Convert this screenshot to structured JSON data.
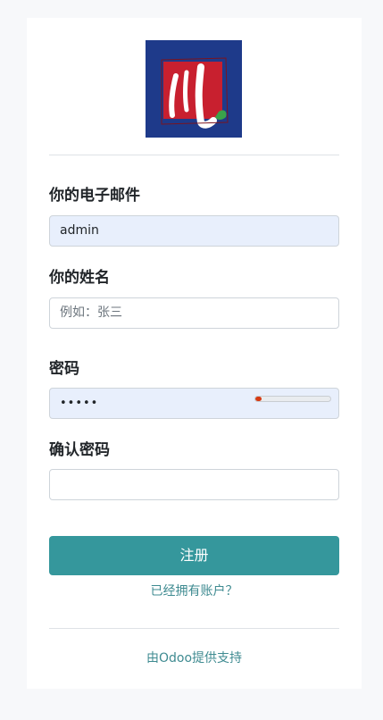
{
  "form": {
    "email_label": "你的电子邮件",
    "email_value": "admin",
    "name_label": "你的姓名",
    "name_placeholder": "例如：张三",
    "password_label": "密码",
    "password_mask": "•••••",
    "password_strength": 0.08,
    "confirm_label": "确认密码",
    "confirm_value": "",
    "submit_label": "注册",
    "login_link": "已经拥有账户？"
  },
  "footer": {
    "powered_by": "由Odoo提供支持"
  },
  "colors": {
    "primary": "#35979c",
    "link": "#3f8b91",
    "logo_bg": "#1e3a8a",
    "logo_red": "#c8202f",
    "strength": "#d63b14"
  }
}
